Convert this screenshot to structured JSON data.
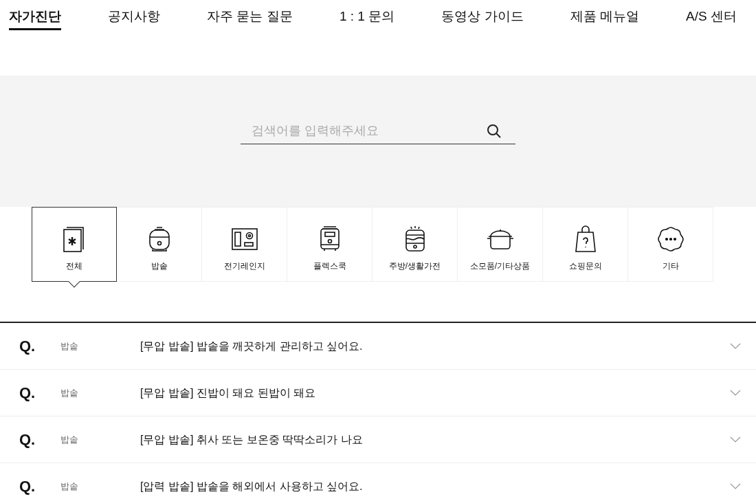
{
  "tabs": [
    {
      "label": "자가진단",
      "selected": true
    },
    {
      "label": "공지사항",
      "selected": false
    },
    {
      "label": "자주 묻는 질문",
      "selected": false
    },
    {
      "label": "1 : 1 문의",
      "selected": false
    },
    {
      "label": "동영상 가이드",
      "selected": false
    },
    {
      "label": "제품 메뉴얼",
      "selected": false
    },
    {
      "label": "A/S 센터",
      "selected": false
    }
  ],
  "search": {
    "placeholder": "검색어를 입력해주세요"
  },
  "categories": [
    {
      "label": "전체",
      "selected": true
    },
    {
      "label": "밥솥",
      "selected": false
    },
    {
      "label": "전기레인지",
      "selected": false
    },
    {
      "label": "플렉스쿡",
      "selected": false
    },
    {
      "label": "주방/생활가전",
      "selected": false
    },
    {
      "label": "소모품/기타상품",
      "selected": false
    },
    {
      "label": "쇼핑문의",
      "selected": false
    },
    {
      "label": "기타",
      "selected": false
    }
  ],
  "faq": [
    {
      "marker": "Q.",
      "category": "밥솥",
      "question": "[무압 밥솥] 밥솥을 깨끗하게 관리하고 싶어요."
    },
    {
      "marker": "Q.",
      "category": "밥솥",
      "question": "[무압 밥솥] 진밥이 돼요 된밥이 돼요"
    },
    {
      "marker": "Q.",
      "category": "밥솥",
      "question": "[무압 밥솥] 취사 또는 보온중 딱딱소리가 나요"
    },
    {
      "marker": "Q.",
      "category": "밥솥",
      "question": "[압력 밥솥] 밥솥을 해외에서 사용하고 싶어요."
    }
  ]
}
